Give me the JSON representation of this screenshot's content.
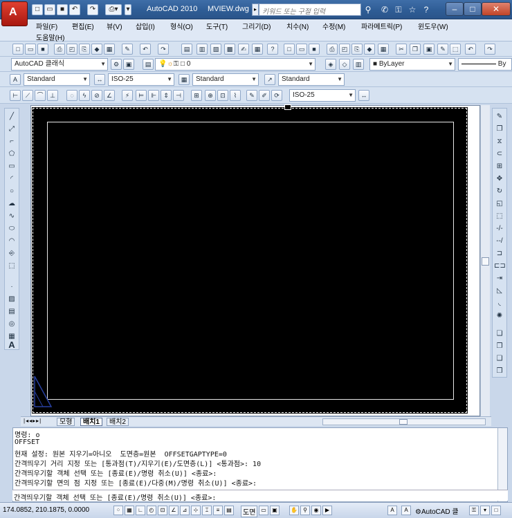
{
  "titlebar": {
    "app_title": "AutoCAD 2010",
    "file_name": "MVIEW.dwg",
    "search_placeholder": "키워드 또는 구절 입력"
  },
  "menu": {
    "items": [
      "파일(F)",
      "편집(E)",
      "뷰(V)",
      "삽입(I)",
      "형식(O)",
      "도구(T)",
      "그리기(D)",
      "치수(N)",
      "수정(M)",
      "파라메트릭(P)",
      "윈도우(W)"
    ],
    "help": "도움말(H)"
  },
  "toolbars": {
    "workspace": "AutoCAD 클래식",
    "layer": "0",
    "bylayer": "ByLayer",
    "bylayer2": "By",
    "textstyle": "Standard",
    "dimstyle": "ISO-25",
    "tablestyle": "Standard",
    "mleaderstyle": "Standard",
    "dimstyle2": "ISO-25"
  },
  "layout_tabs": {
    "model": "모형",
    "layout1": "배치1",
    "layout2": "배치2"
  },
  "command": {
    "lines": [
      "명령: o",
      "OFFSET",
      "현재 설정: 원본 지우기=아니오  도면층=원본  OFFSETGAPTYPE=0",
      "간격띄우기 거리 지정 또는 [통과점(T)/지우기(E)/도면층(L)] <통과점>: 10",
      "간격띄우기할 객체 선택 또는 [종료(E)/명령 취소(U)] <종료>:",
      "간격띄우기할 면의 점 지정 또는 [종료(E)/다중(M)/명령 취소(U)] <종료>:"
    ],
    "prompt": "간격띄우기할 객체 선택 또는 [종료(E)/명령 취소(U)] <종료>:"
  },
  "status": {
    "coords": "174.0852, 210.1875, 0.0000",
    "paper": "도면",
    "workspace": "AutoCAD 클"
  }
}
